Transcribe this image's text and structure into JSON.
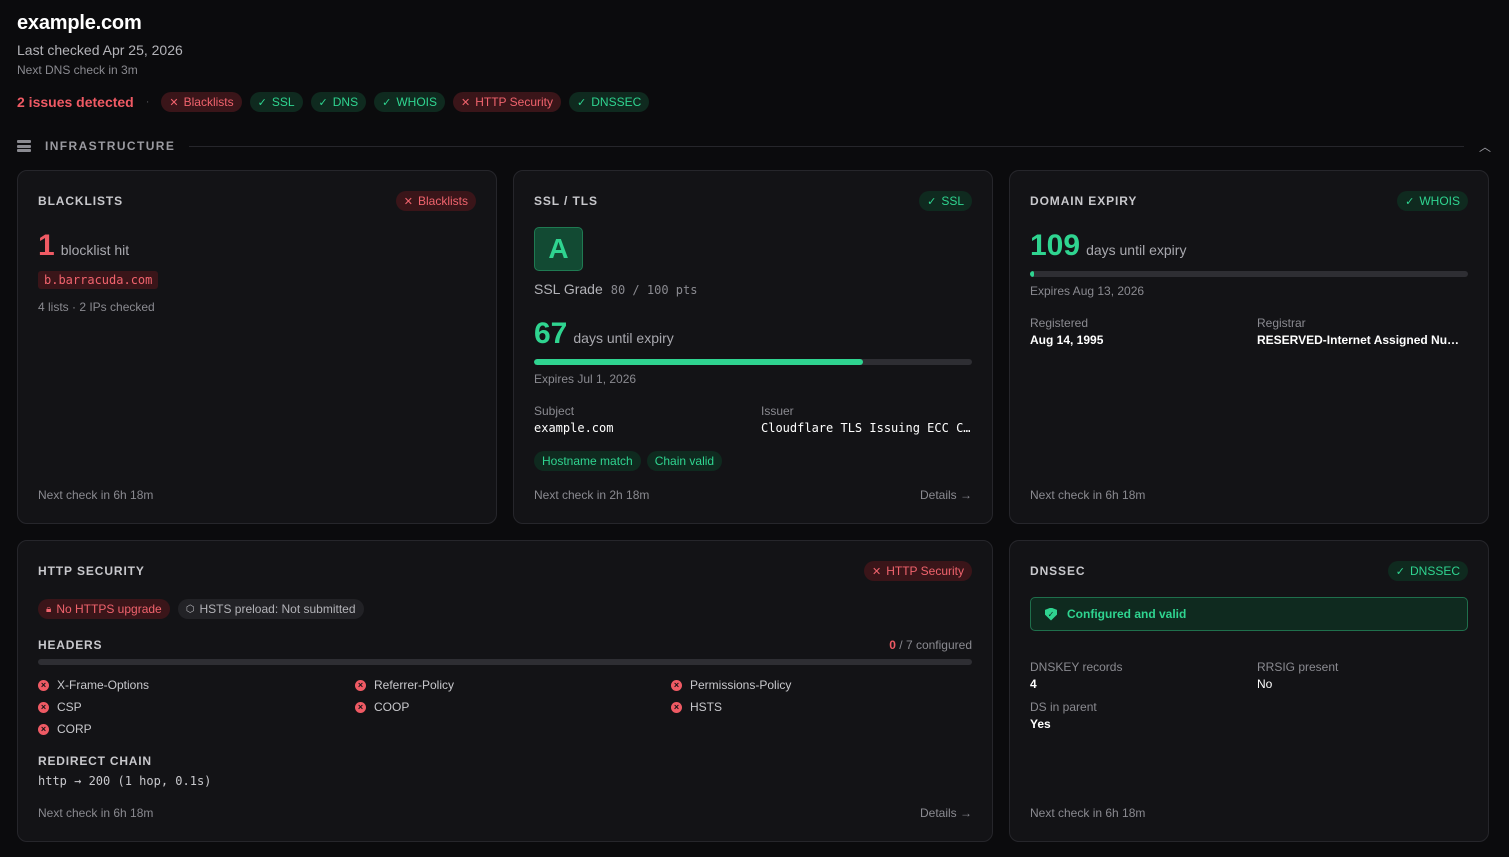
{
  "header": {
    "domain": "example.com",
    "last_checked": "Last checked Apr 25, 2026",
    "next_dns": "Next DNS check in 3m"
  },
  "status": {
    "issues": "2 issues detected",
    "separator": "·",
    "pills": [
      {
        "label": "Blacklists",
        "state": "fail"
      },
      {
        "label": "SSL",
        "state": "pass"
      },
      {
        "label": "DNS",
        "state": "pass"
      },
      {
        "label": "WHOIS",
        "state": "pass"
      },
      {
        "label": "HTTP Security",
        "state": "fail"
      },
      {
        "label": "DNSSEC",
        "state": "pass"
      }
    ]
  },
  "section": {
    "title": "INFRASTRUCTURE",
    "icon": "server-icon",
    "collapse_icon": "chevron-up-icon"
  },
  "blacklists": {
    "title": "BLACKLISTS",
    "badge": "Blacklists",
    "count": "1",
    "count_label": "blocklist hit",
    "hit": "b.barracuda.com",
    "meta": "4 lists · 2 IPs checked",
    "footer": "Next check in 6h 18m"
  },
  "ssl": {
    "title": "SSL / TLS",
    "badge": "SSL",
    "grade": "A",
    "grade_label": "SSL Grade",
    "grade_pts": "80 / 100 pts",
    "days": "67",
    "days_label": "days until expiry",
    "expiry_progress": 0.75,
    "expires": "Expires Jul 1, 2026",
    "subject_label": "Subject",
    "subject": "example.com",
    "issuer_label": "Issuer",
    "issuer": "Cloudflare TLS Issuing ECC C…",
    "tags": [
      "Hostname match",
      "Chain valid"
    ],
    "footer": "Next check in 2h 18m",
    "details": "Details →"
  },
  "domain_expiry": {
    "title": "DOMAIN EXPIRY",
    "badge": "WHOIS",
    "days": "109",
    "days_label": "days until expiry",
    "expiry_progress": 0.01,
    "expires": "Expires Aug 13, 2026",
    "registered_label": "Registered",
    "registered": "Aug 14, 1995",
    "registrar_label": "Registrar",
    "registrar": "RESERVED-Internet Assigned Num…",
    "footer": "Next check in 6h 18m"
  },
  "http_security": {
    "title": "HTTP SECURITY",
    "badge": "HTTP Security",
    "no_https": "No HTTPS upgrade",
    "hsts_preload": "HSTS preload: Not submitted",
    "headers_title": "HEADERS",
    "configured_count": "0",
    "configured_total": " / 7 configured",
    "configured_fraction": 0,
    "headers": [
      "X-Frame-Options",
      "Referrer-Policy",
      "Permissions-Policy",
      "CSP",
      "COOP",
      "HSTS",
      "CORP"
    ],
    "redirect_title": "REDIRECT CHAIN",
    "redirect": "http → 200 (1 hop, 0.1s)",
    "footer": "Next check in 6h 18m",
    "details": "Details →"
  },
  "dnssec": {
    "title": "DNSSEC",
    "badge": "DNSSEC",
    "status": "Configured and valid",
    "dnskey_label": "DNSKEY records",
    "dnskey": "4",
    "rrsig_label": "RRSIG present",
    "rrsig": "No",
    "ds_label": "DS in parent",
    "ds": "Yes",
    "footer": "Next check in 6h 18m"
  }
}
